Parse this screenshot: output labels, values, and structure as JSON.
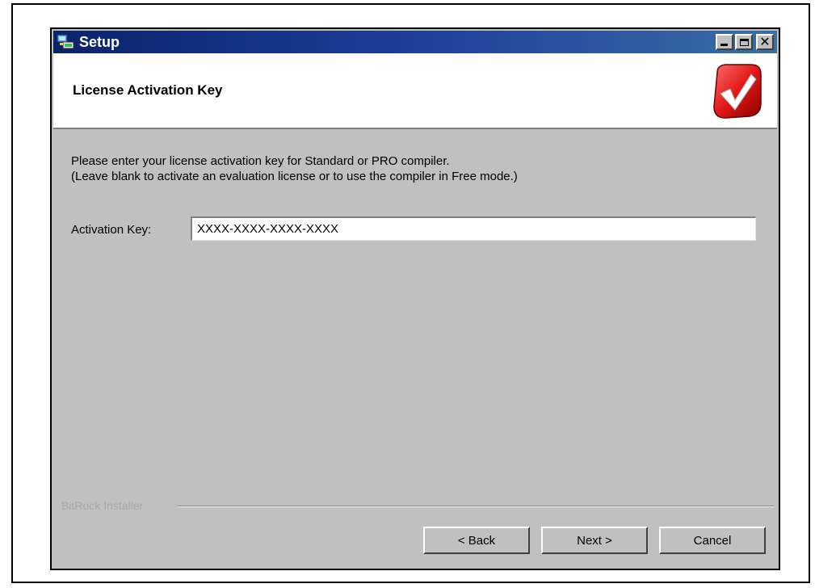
{
  "window": {
    "title": "Setup",
    "title_icon": "setup-computer-icon",
    "controls": [
      "minimize-icon",
      "maximize-icon",
      "close-icon"
    ],
    "titlebar_color": "#0a246a"
  },
  "header": {
    "title": "License Activation Key",
    "logo_icon": "red-checkmark-logo-icon",
    "logo_color": "#d81f1f"
  },
  "content": {
    "instruction_line1": "Please enter your license activation key for Standard or PRO compiler.",
    "instruction_line2": "(Leave blank to activate an evaluation license or to use the compiler in Free mode.)",
    "key_label": "Activation Key:",
    "key_value": "XXXX-XXXX-XXXX-XXXX"
  },
  "footer": {
    "installer_label": "BitRock Installer",
    "back_label": "< Back",
    "next_label": "Next >",
    "cancel_label": "Cancel"
  }
}
